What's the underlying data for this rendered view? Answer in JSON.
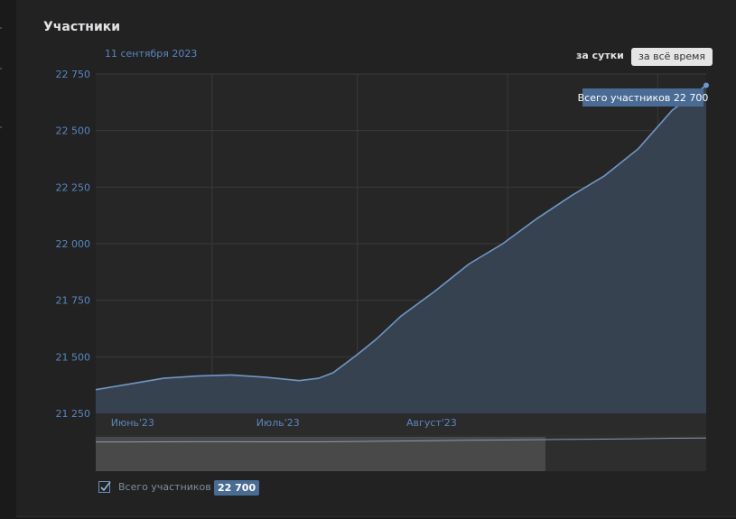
{
  "header": {
    "title": "Участники",
    "date_label": "11 сентября 2023"
  },
  "range_buttons": {
    "day": "за сутки",
    "all_time": "за всё время"
  },
  "tooltip": {
    "text": "Всего участников 22 700"
  },
  "legend": {
    "label": "Всего участников",
    "value": "22 700",
    "checked": true
  },
  "colors": {
    "line": "#6f97c8",
    "area": "#374250",
    "tooltip_bg": "#4a6b94",
    "accent": "#5a86c0"
  },
  "chart_data": {
    "type": "area",
    "title": "",
    "xlabel": "",
    "ylabel": "",
    "ylim": [
      21250,
      22750
    ],
    "yticks": [
      {
        "value": 21250,
        "label": "21 250"
      },
      {
        "value": 21500,
        "label": "21 500"
      },
      {
        "value": 21750,
        "label": "21 750"
      },
      {
        "value": 22000,
        "label": "22 000"
      },
      {
        "value": 22250,
        "label": "22 250"
      },
      {
        "value": 22500,
        "label": "22 500"
      },
      {
        "value": 22750,
        "label": "22 750"
      }
    ],
    "xlim": [
      "2023-05-08",
      "2023-09-11"
    ],
    "xticks": [
      {
        "value": "2023-06-01",
        "label": "Июнь'23"
      },
      {
        "value": "2023-07-01",
        "label": "Июль'23"
      },
      {
        "value": "2023-08-01",
        "label": "Август'23"
      },
      {
        "value": "2023-09-01",
        "label": ""
      }
    ],
    "series": [
      {
        "name": "Всего участников",
        "x": [
          "2023-05-08",
          "2023-05-15",
          "2023-05-22",
          "2023-05-29",
          "2023-06-05",
          "2023-06-12",
          "2023-06-19",
          "2023-06-23",
          "2023-06-26",
          "2023-07-01",
          "2023-07-05",
          "2023-07-10",
          "2023-07-17",
          "2023-07-24",
          "2023-07-31",
          "2023-08-07",
          "2023-08-14",
          "2023-08-21",
          "2023-08-28",
          "2023-09-04",
          "2023-09-11"
        ],
        "values": [
          21355,
          21380,
          21405,
          21415,
          21420,
          21410,
          21395,
          21405,
          21430,
          21510,
          21580,
          21680,
          21790,
          21910,
          22000,
          22110,
          22210,
          22300,
          22420,
          22590,
          22700
        ]
      }
    ]
  }
}
